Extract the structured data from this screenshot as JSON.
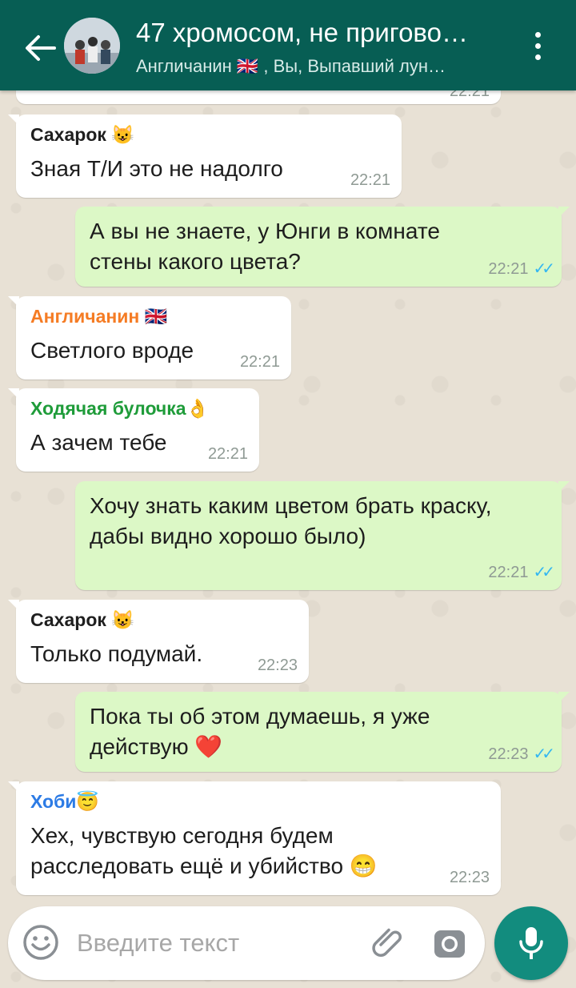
{
  "header": {
    "title": "47 хромосом, не пригово…",
    "subtitle": "Англичанин 🇬🇧 , Вы, Выпавший лун…"
  },
  "colors": {
    "appbar": "#075e54",
    "outgoing_bubble": "#dcf8c6",
    "incoming_bubble": "#ffffff",
    "read_ticks": "#34b7f1",
    "mic_button": "#128c7e"
  },
  "messages": [
    {
      "id": "m0",
      "direction": "in",
      "sender": "",
      "text": "",
      "time": "22:21"
    },
    {
      "id": "m1",
      "direction": "in",
      "sender": "Сахарок 😺",
      "sender_color": "#1f1f1f",
      "text": "Зная Т/И это не надолго",
      "time": "22:21"
    },
    {
      "id": "m2",
      "direction": "out",
      "text": "А вы не знаете, у Юнги в комнате стены какого цвета?",
      "time": "22:21",
      "status": "read"
    },
    {
      "id": "m3",
      "direction": "in",
      "sender": "Англичанин 🇬🇧",
      "sender_color": "#f57c24",
      "text": "Светлого вроде",
      "time": "22:21"
    },
    {
      "id": "m4",
      "direction": "in",
      "sender": "Ходячая булочка👌",
      "sender_color": "#1f9c3a",
      "text": "А зачем тебе",
      "time": "22:21"
    },
    {
      "id": "m5",
      "direction": "out",
      "text": "Хочу знать каким цветом брать краску, дабы видно хорошо было)",
      "time": "22:21",
      "status": "read"
    },
    {
      "id": "m6",
      "direction": "in",
      "sender": "Сахарок 😺",
      "sender_color": "#1f1f1f",
      "text": "Только подумай.",
      "time": "22:23"
    },
    {
      "id": "m7",
      "direction": "out",
      "text": "Пока ты об этом думаешь, я уже действую ❤️",
      "time": "22:23",
      "status": "read"
    },
    {
      "id": "m8",
      "direction": "in",
      "sender": "Хоби😇",
      "sender_color": "#2c7be5",
      "text": "Хех, чувствую сегодня будем расследовать ещё и убийство 😁",
      "time": "22:23"
    }
  ],
  "composer": {
    "placeholder": "Введите текст"
  },
  "icons": {
    "back": "arrow-left-icon",
    "menu": "more-vertical-icon",
    "emoji": "smiley-icon",
    "attach": "paperclip-icon",
    "camera": "camera-icon",
    "mic": "microphone-icon"
  }
}
